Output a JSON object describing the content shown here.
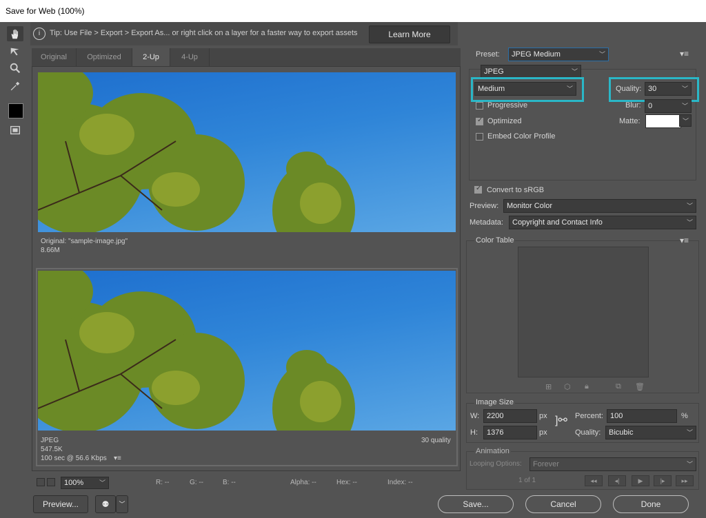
{
  "window": {
    "title": "Save for Web (100%)"
  },
  "tip": {
    "icon": "info-icon",
    "text": "Tip: Use File > Export > Export As...  or right click on a layer for a faster way to export assets",
    "learn_more": "Learn More"
  },
  "tabs": [
    {
      "label": "Original"
    },
    {
      "label": "Optimized"
    },
    {
      "label": "2-Up"
    },
    {
      "label": "4-Up"
    }
  ],
  "active_tab": "2-Up",
  "original": {
    "name": "Original: \"sample-image.jpg\"",
    "size": "8.66M"
  },
  "optimized": {
    "format": "JPEG",
    "size": "547.5K",
    "speed": "100 sec @ 56.6 Kbps",
    "quality_label": "30 quality"
  },
  "bottom": {
    "zoom": "100%",
    "r": "R: --",
    "g": "G: --",
    "b": "B: --",
    "alpha": "Alpha: --",
    "hex": "Hex: --",
    "index": "Index: --"
  },
  "settings": {
    "preset_label": "Preset:",
    "preset_value": "JPEG Medium",
    "format_value": "JPEG",
    "quality_level": "Medium",
    "quality_label": "Quality:",
    "quality_value": "30",
    "progressive": "Progressive",
    "blur_label": "Blur:",
    "blur_value": "0",
    "optimized": "Optimized",
    "matte_label": "Matte:",
    "embed": "Embed Color Profile",
    "convert": "Convert to sRGB",
    "preview_label": "Preview:",
    "preview_value": "Monitor Color",
    "metadata_label": "Metadata:",
    "metadata_value": "Copyright and Contact Info"
  },
  "color_table": {
    "title": "Color Table"
  },
  "image_size": {
    "title": "Image Size",
    "w_label": "W:",
    "w_value": "2200",
    "h_label": "H:",
    "h_value": "1376",
    "unit": "px",
    "percent_label": "Percent:",
    "percent_value": "100",
    "percent_unit": "%",
    "quality_label": "Quality:",
    "quality_value": "Bicubic"
  },
  "animation": {
    "title": "Animation",
    "looping_label": "Looping Options:",
    "looping_value": "Forever",
    "frame": "1 of 1"
  },
  "buttons": {
    "preview": "Preview...",
    "save": "Save...",
    "cancel": "Cancel",
    "done": "Done"
  },
  "colors": {
    "highlight": "#2ab7c7",
    "bg": "#535353"
  }
}
